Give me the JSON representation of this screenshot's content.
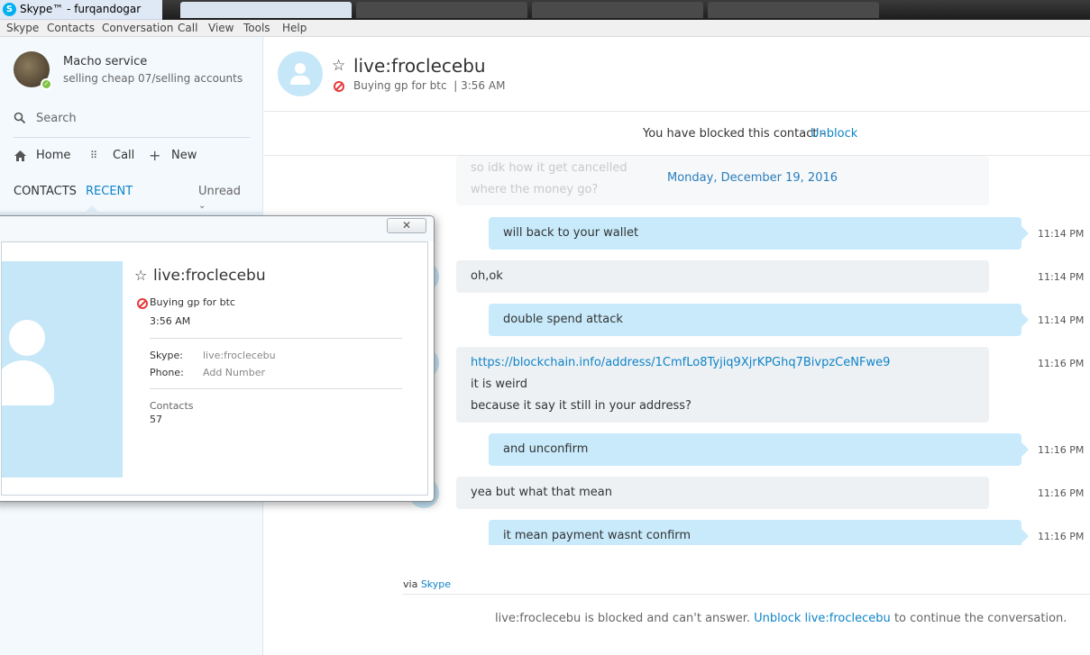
{
  "window": {
    "title": "Skype™ - furqandogar"
  },
  "menu": [
    "Skype",
    "Contacts",
    "Conversation",
    "Call",
    "View",
    "Tools",
    "Help"
  ],
  "profile": {
    "name": "Macho service",
    "mood": "selling cheap 07/selling accounts"
  },
  "sidebar": {
    "search_label": "Search",
    "nav": {
      "home": "Home",
      "call": "Call",
      "new": "New"
    },
    "tabs": {
      "contacts": "CONTACTS",
      "recent": "RECENT",
      "unread": "Unread"
    }
  },
  "conversation": {
    "contact_name": "live:froclecebu",
    "mood": "Buying gp for btc",
    "mood_time": "3:56 AM",
    "blocked_banner": "You have blocked this contact -",
    "unblock_label": "Unblock",
    "date_label": "Monday, December 19, 2016",
    "ghost_lines": [
      "so idk how it get cancelled",
      "where the money go?"
    ],
    "messages": [
      {
        "dir": "out",
        "lines": [
          "will back to your wallet"
        ],
        "time": "11:14 PM"
      },
      {
        "dir": "in",
        "lines": [
          "oh,ok"
        ],
        "time": "11:14 PM"
      },
      {
        "dir": "out",
        "lines": [
          "double spend attack"
        ],
        "time": "11:14 PM"
      },
      {
        "dir": "in",
        "lines": [
          "https://blockchain.info/address/1CmfLo8Tyjiq9XjrKPGhq7BivpzCeNFwe9",
          "it is weird",
          "because it say it still in your address?"
        ],
        "time": "11:16 PM"
      },
      {
        "dir": "out",
        "lines": [
          "and unconfirm"
        ],
        "time": "11:16 PM"
      },
      {
        "dir": "in",
        "lines": [
          "yea but what that mean"
        ],
        "time": "11:16 PM"
      },
      {
        "dir": "out",
        "lines": [
          "it mean payment wasnt confirm"
        ],
        "time": "11:16 PM"
      }
    ],
    "via_prefix": "via",
    "via_link": "Skype",
    "footer": {
      "prefix": "live:froclecebu is blocked and can't answer.",
      "link": "Unblock live:froclecebu",
      "suffix": "to continue the conversation."
    }
  },
  "popup": {
    "close_label": "✕",
    "name": "live:froclecebu",
    "mood": "Buying gp for btc",
    "time": "3:56 AM",
    "skype_key": "Skype:",
    "skype_val": "live:froclecebu",
    "phone_key": "Phone:",
    "phone_val": "Add Number",
    "contacts_label": "Contacts",
    "contacts_count": "57"
  },
  "colors": {
    "accent": "#0e84c8",
    "incoming_bubble": "#eef1f4",
    "outgoing_bubble": "#c8eafb",
    "blocked": "#e43b3b",
    "presence": "#7dc242"
  }
}
